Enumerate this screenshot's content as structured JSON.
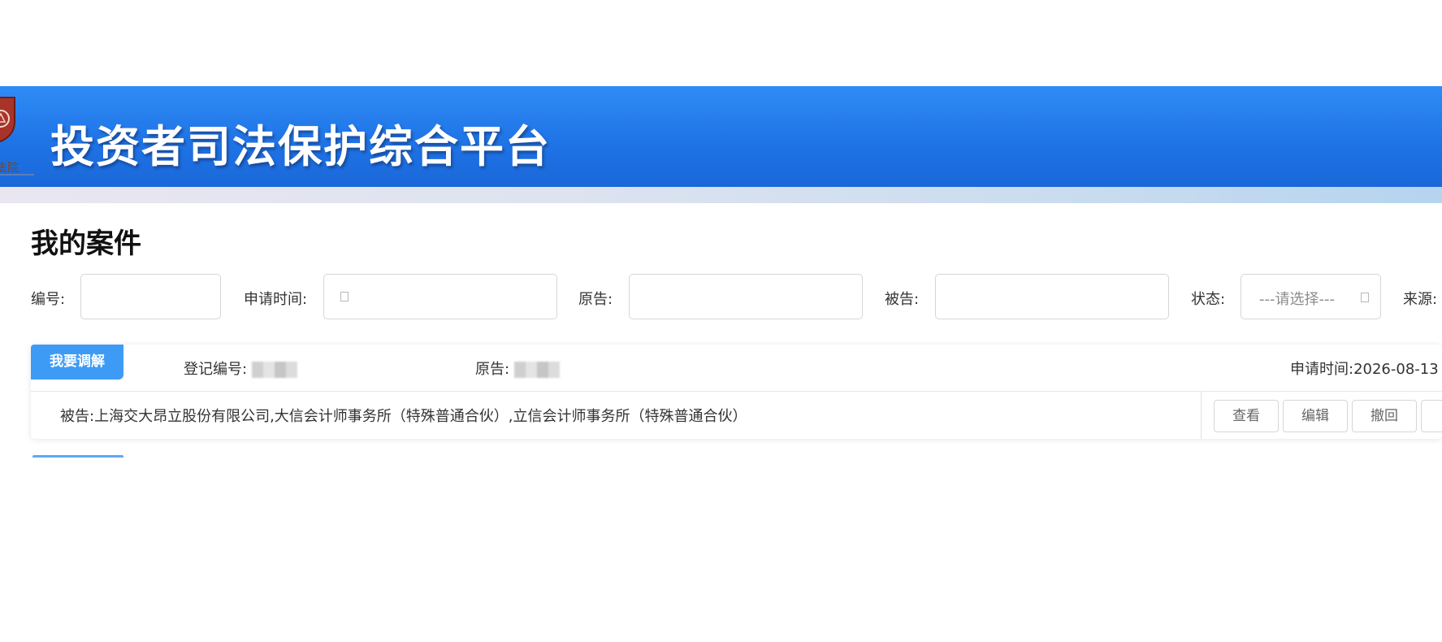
{
  "header": {
    "title": "投资者司法保护综合平台",
    "emblem_caption": "法院"
  },
  "page": {
    "title": "我的案件"
  },
  "filters": {
    "number_label": "编号:",
    "number_value": "",
    "apply_time_label": "申请时间:",
    "apply_time_value": "",
    "plaintiff_label": "原告:",
    "plaintiff_value": "",
    "defendant_label": "被告:",
    "defendant_value": "",
    "status_label": "状态:",
    "status_selected": "---请选择---",
    "source_label": "来源:"
  },
  "case": {
    "mediate_button": "我要调解",
    "reg_number_label": "登记编号:",
    "plaintiff_label": "原告:",
    "apply_time_label": "申请时间:",
    "apply_time_value": "2026-08-13",
    "defendant_label": "被告:",
    "defendant_value": "上海交大昂立股份有限公司,大信会计师事务所（特殊普通合伙）,立信会计师事务所（特殊普通合伙）",
    "actions": {
      "view": "查看",
      "edit": "编辑",
      "withdraw": "撤回"
    }
  },
  "icons": {
    "calendar": "calendar-icon",
    "dropdown": "chevron-down-icon",
    "emblem": "court-emblem-icon"
  },
  "colors": {
    "banner": "#1f74e6",
    "accent": "#3e9bf5"
  }
}
